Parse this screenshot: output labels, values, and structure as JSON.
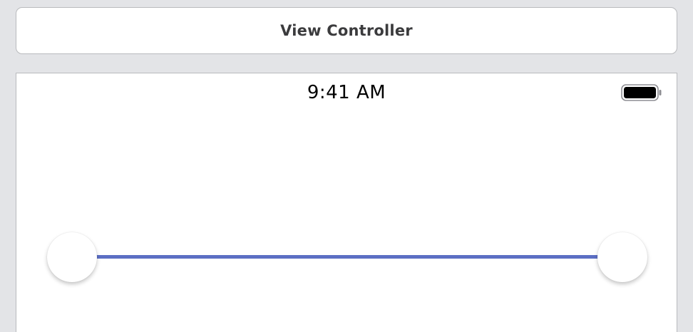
{
  "header": {
    "title": "View Controller"
  },
  "status_bar": {
    "time": "9:41 AM",
    "battery_icon": "battery-full-icon"
  },
  "range_slider": {
    "lower_value": 0,
    "upper_value": 1,
    "track_color": "#5c6fc4"
  },
  "colors": {
    "background": "#e3e4e7",
    "border": "#b9babd",
    "accent": "#5c6fc4"
  }
}
